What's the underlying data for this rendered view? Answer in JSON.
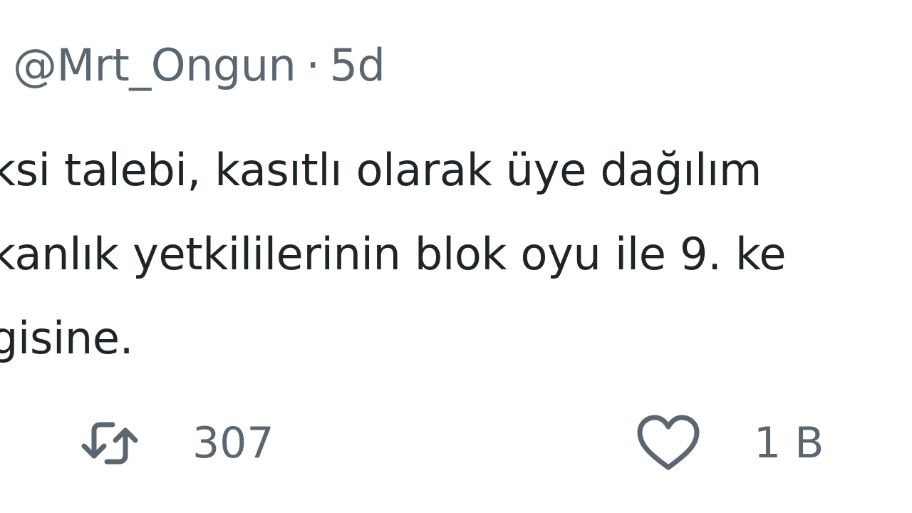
{
  "tweet": {
    "handle": "@Mrt_Ongun",
    "separator": "·",
    "time": "5d",
    "text_lines": [
      "ksi talebi, kasıtlı olarak üye dağılım",
      "kanlık yetkililerinin blok oyu ile 9. ke",
      "gisine."
    ]
  },
  "actions": {
    "retweet": {
      "icon": "retweet-icon",
      "count": "307"
    },
    "like": {
      "icon": "heart-icon",
      "count": "1 B"
    }
  },
  "colors": {
    "text_primary": "#1f2428",
    "text_secondary": "#5b6670",
    "background": "#ffffff"
  }
}
